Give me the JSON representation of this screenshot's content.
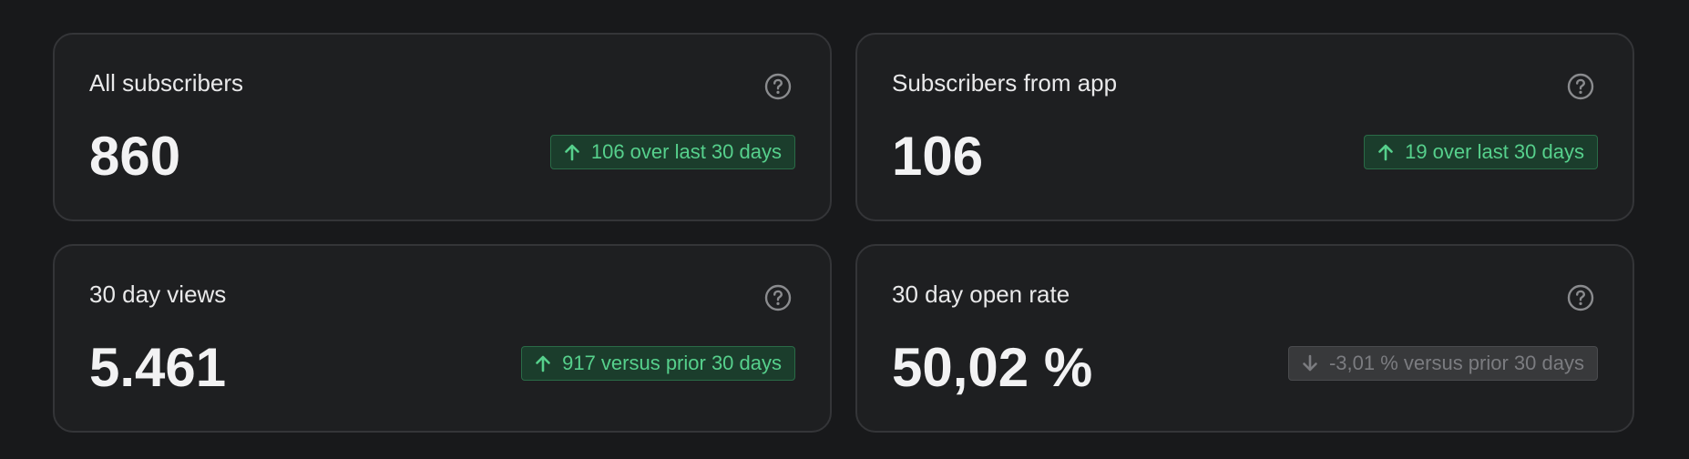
{
  "colors": {
    "background": "#18191b",
    "card_background": "#1e1f21",
    "card_border": "#343538",
    "positive": "#56d08c",
    "positive_badge_bg": "#1b3d2c",
    "neutral_badge_text": "#7b7c80",
    "neutral_badge_bg": "#38393b"
  },
  "cards": [
    {
      "title": "All subscribers",
      "value": "860",
      "trend": "up",
      "trend_icon": "arrow-up-icon",
      "delta_text": "106 over last 30 days",
      "help_icon": "question-circle-icon"
    },
    {
      "title": "Subscribers from app",
      "value": "106",
      "trend": "up",
      "trend_icon": "arrow-up-icon",
      "delta_text": "19 over last 30 days",
      "help_icon": "question-circle-icon"
    },
    {
      "title": "30 day views",
      "value": "5.461",
      "trend": "up",
      "trend_icon": "arrow-up-icon",
      "delta_text": "917 versus prior 30 days",
      "help_icon": "question-circle-icon"
    },
    {
      "title": "30 day open rate",
      "value": "50,02 %",
      "trend": "down",
      "trend_icon": "arrow-down-icon",
      "delta_text": "-3,01 % versus prior 30 days",
      "help_icon": "question-circle-icon"
    }
  ]
}
